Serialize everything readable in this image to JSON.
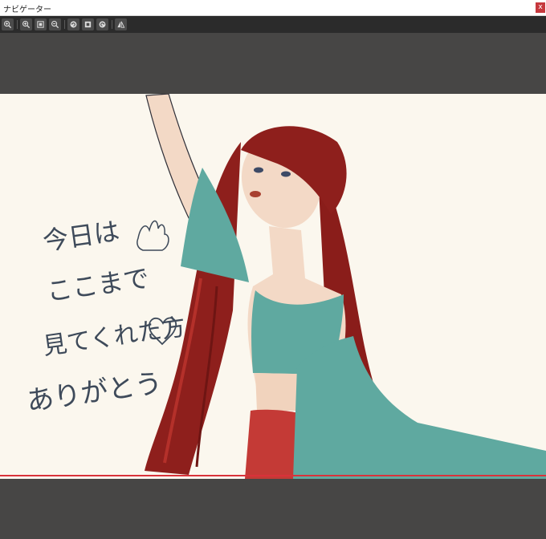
{
  "window": {
    "title": "ナビゲーター",
    "close_label": "x"
  },
  "toolbar": {
    "buttons": [
      {
        "icon": "zoom-fit-icon"
      },
      {
        "icon": "zoom-in-icon"
      },
      {
        "icon": "fit-window-icon"
      },
      {
        "icon": "zoom-out-icon"
      },
      {
        "icon": "rotate-left-icon"
      },
      {
        "icon": "reset-view-icon"
      },
      {
        "icon": "rotate-right-icon"
      },
      {
        "icon": "flip-horizontal-icon"
      }
    ]
  },
  "artwork": {
    "handwriting_lines": [
      "今日は",
      "ここまで",
      "見てくれた方",
      "ありがとう"
    ],
    "colors": {
      "paper": "#fbf7ee",
      "hair": "#8e1f1c",
      "cloth": "#5fa9a0",
      "skin": "#f3d9c6",
      "scales": "#c43a36"
    }
  },
  "navigator_frame_color": "#d9323a"
}
